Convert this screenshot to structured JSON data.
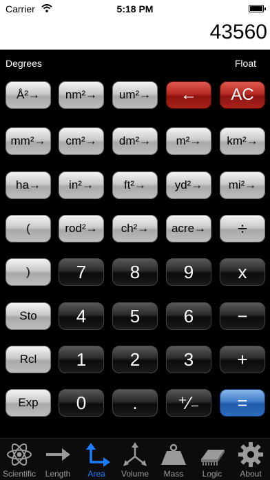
{
  "status_bar": {
    "carrier": "Carrier",
    "time": "5:18 PM",
    "wifi_icon": "wifi-icon",
    "battery_icon": "battery-icon"
  },
  "display": {
    "value": "43560"
  },
  "modes": {
    "angle": "Degrees",
    "format": "Float"
  },
  "keypad": {
    "rows": [
      [
        "Å²→",
        "nm²→",
        "um²→",
        "←",
        "AC"
      ],
      [
        "mm²→",
        "cm²→",
        "dm²→",
        "m²→",
        "km²→"
      ],
      [
        "ha→",
        "in²→",
        "ft²→",
        "yd²→",
        "mi²→"
      ],
      [
        "(",
        "rod²→",
        "ch²→",
        "acre→",
        "÷"
      ],
      [
        ")",
        "7",
        "8",
        "9",
        "x"
      ],
      [
        "Sto",
        "4",
        "5",
        "6",
        "−"
      ],
      [
        "Rcl",
        "1",
        "2",
        "3",
        "+"
      ],
      [
        "Exp",
        "0",
        ".",
        "⁺⁄₋",
        "="
      ]
    ]
  },
  "colors": {
    "gray_key": "#c9c9c9",
    "black_key": "#1a1a1a",
    "red_key": "#b82a22",
    "blue_key": "#2d6cbc",
    "active_tab": "#1a7cff",
    "inactive_tab": "#9a9a9a"
  },
  "tabs": [
    {
      "label": "Scientific",
      "icon": "atom-icon",
      "active": false
    },
    {
      "label": "Length",
      "icon": "arrow-right-icon",
      "active": false
    },
    {
      "label": "Area",
      "icon": "corner-arrows-icon",
      "active": true
    },
    {
      "label": "Volume",
      "icon": "three-axes-icon",
      "active": false
    },
    {
      "label": "Mass",
      "icon": "weight-icon",
      "active": false
    },
    {
      "label": "Logic",
      "icon": "chip-icon",
      "active": false
    },
    {
      "label": "About",
      "icon": "gear-icon",
      "active": false
    }
  ]
}
